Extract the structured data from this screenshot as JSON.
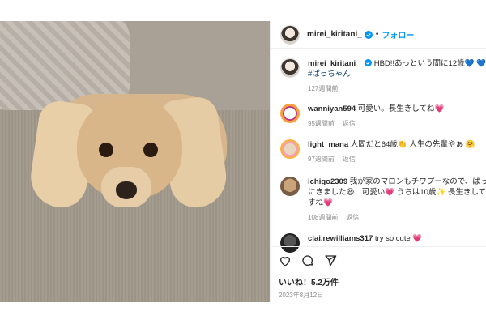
{
  "post": {
    "username": "mirei_kiritani_",
    "follow_label": "フォロー",
    "separator": "•",
    "caption": "HBD!!あっという間に12歳💙 💙 💙",
    "hashtag": "#ぱっちゃん",
    "caption_time": "127週間前",
    "likes": "いいね！5.2万件",
    "date": "2023年8月12日"
  },
  "comments": [
    {
      "user": "wanniyan594",
      "text": "可愛い。長生きしてね",
      "emoji": "💗",
      "time": "95週間前",
      "reply": "返信"
    },
    {
      "user": "light_mana",
      "text": "人間だと64歳👏 人生の先輩やぁ 🤗",
      "emoji": "",
      "time": "97週間前",
      "reply": "返信"
    },
    {
      "user": "ichigo2309",
      "text": "我が家のマロンもチワプーなので、ぱって",
      "line2": "にきました😆　可愛い💗 うちは10歳✨ 長生きして",
      "line3": "すね",
      "emoji": "💗",
      "time": "108週間前",
      "reply": "返信"
    },
    {
      "user": "clai.rewilliams317",
      "text": "try so cute",
      "emoji": "💗"
    }
  ],
  "icons": [
    "verified-badge-icon",
    "heart-icon",
    "comment-icon",
    "share-icon"
  ],
  "colors": {
    "link": "#0095f6",
    "hashtag": "#00376b",
    "heart": "#ed4956",
    "meta": "#8e8e8e"
  }
}
